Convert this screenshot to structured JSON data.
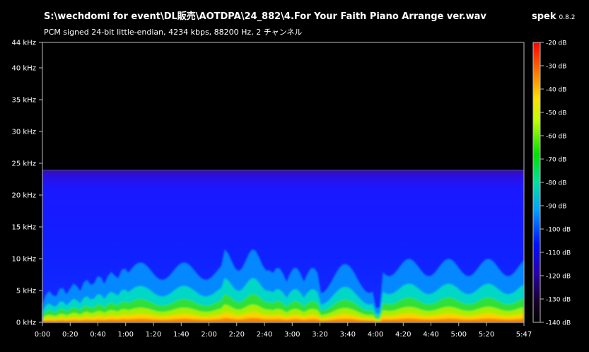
{
  "file_path": "S:\\wechdomi for event\\DL販売\\AOTDPA\\24_882\\4.For Your Faith Piano Arrange ver.wav",
  "file_info": "PCM signed 24-bit little-endian, 4234 kbps, 88200 Hz, 2 チャンネル",
  "app": {
    "name": "spek",
    "version": "0.8.2"
  },
  "chart_data": {
    "type": "heatmap",
    "x_axis": {
      "unit": "time",
      "range_seconds": [
        0,
        347
      ],
      "ticks": [
        "0:00",
        "0:20",
        "0:40",
        "1:00",
        "1:20",
        "1:40",
        "2:00",
        "2:20",
        "2:40",
        "3:00",
        "3:20",
        "3:40",
        "4:00",
        "4:20",
        "4:40",
        "5:00",
        "5:20",
        "5:47"
      ]
    },
    "y_axis": {
      "unit": "kHz",
      "range": [
        0,
        44
      ],
      "ticks": [
        "0 kHz",
        "5 kHz",
        "10 kHz",
        "15 kHz",
        "20 kHz",
        "25 kHz",
        "30 kHz",
        "35 kHz",
        "40 kHz",
        "44 kHz"
      ]
    },
    "color_scale": {
      "unit": "dB",
      "range": [
        -140,
        -20
      ],
      "ticks": [
        "-20 dB",
        "-30 dB",
        "-40 dB",
        "-50 dB",
        "-60 dB",
        "-70 dB",
        "-80 dB",
        "-90 dB",
        "-100 dB",
        "-110 dB",
        "-120 dB",
        "-130 dB",
        "-140 dB"
      ]
    },
    "content_cutoff_khz": 24
  }
}
